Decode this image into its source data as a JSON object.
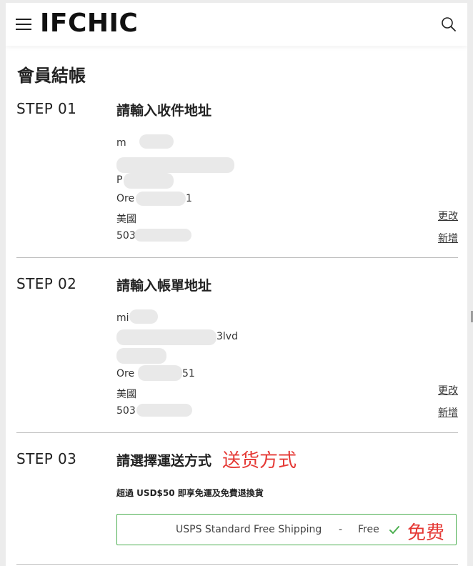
{
  "header": {
    "logo": "IFCHIC"
  },
  "page": {
    "title": "會員結帳"
  },
  "steps": [
    {
      "label": "STEP 01",
      "title": "請輸入收件地址",
      "lines": [
        "m",
        "",
        "P",
        "Ore",
        "美國",
        "503"
      ],
      "line_tails": [
        "",
        "",
        "",
        "1",
        "",
        ""
      ],
      "links": [
        "更改",
        "新增"
      ]
    },
    {
      "label": "STEP 02",
      "title": "請輸入帳單地址",
      "lines": [
        "mi",
        "",
        "",
        "Ore",
        "美國",
        "503"
      ],
      "line_tails": [
        "",
        "3lvd",
        "",
        "51",
        "",
        ""
      ],
      "links": [
        "更改",
        "新增"
      ]
    },
    {
      "label": "STEP 03",
      "title": "請選擇運送方式",
      "annotation": "送货方式",
      "note": "超過 USD$50 即享免運及免費退換貨",
      "option": {
        "name": "USPS Standard Free Shipping",
        "separator": "-",
        "price": "Free",
        "annotation": "免费"
      }
    }
  ],
  "colors": {
    "annotation": "#e53935",
    "selected_border": "#4caf50"
  },
  "icons": {
    "menu": "hamburger-icon",
    "search": "search-icon",
    "selected": "checkmark-icon"
  }
}
